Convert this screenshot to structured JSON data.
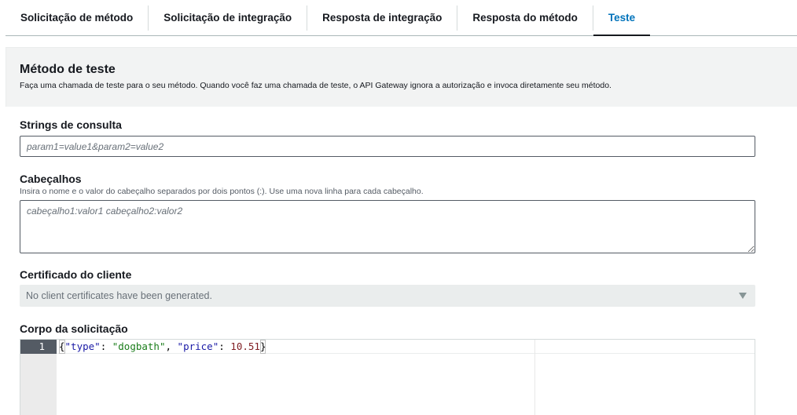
{
  "tabs": [
    {
      "label": "Solicitação de método",
      "active": false
    },
    {
      "label": "Solicitação de integração",
      "active": false
    },
    {
      "label": "Resposta de integração",
      "active": false
    },
    {
      "label": "Resposta do método",
      "active": false
    },
    {
      "label": "Teste",
      "active": true
    }
  ],
  "test": {
    "title": "Método de teste",
    "description": "Faça uma chamada de teste para o seu método. Quando você faz uma chamada de teste, o API Gateway ignora a autorização e invoca diretamente seu método."
  },
  "query_strings": {
    "label": "Strings de consulta",
    "placeholder": "param1=value1&param2=value2"
  },
  "headers": {
    "label": "Cabeçalhos",
    "hint": "Insira o nome e o valor do cabeçalho separados por dois pontos (:). Use uma nova linha para cada cabeçalho.",
    "placeholder": "cabeçalho1:valor1 cabeçalho2:valor2"
  },
  "client_certificate": {
    "label": "Certificado do cliente",
    "selected": "No client certificates have been generated."
  },
  "request_body": {
    "label": "Corpo da solicitação",
    "line_number": "1",
    "code": {
      "open": "{",
      "key1": "\"type\"",
      "colon1": ": ",
      "val1": "\"dogbath\"",
      "comma": ", ",
      "key2": "\"price\"",
      "colon2": ": ",
      "val2": "10.51",
      "close": "}"
    }
  },
  "colors": {
    "accent": "#0073bb",
    "text": "#16191f",
    "muted": "#687078",
    "panel": "#f2f3f3"
  }
}
